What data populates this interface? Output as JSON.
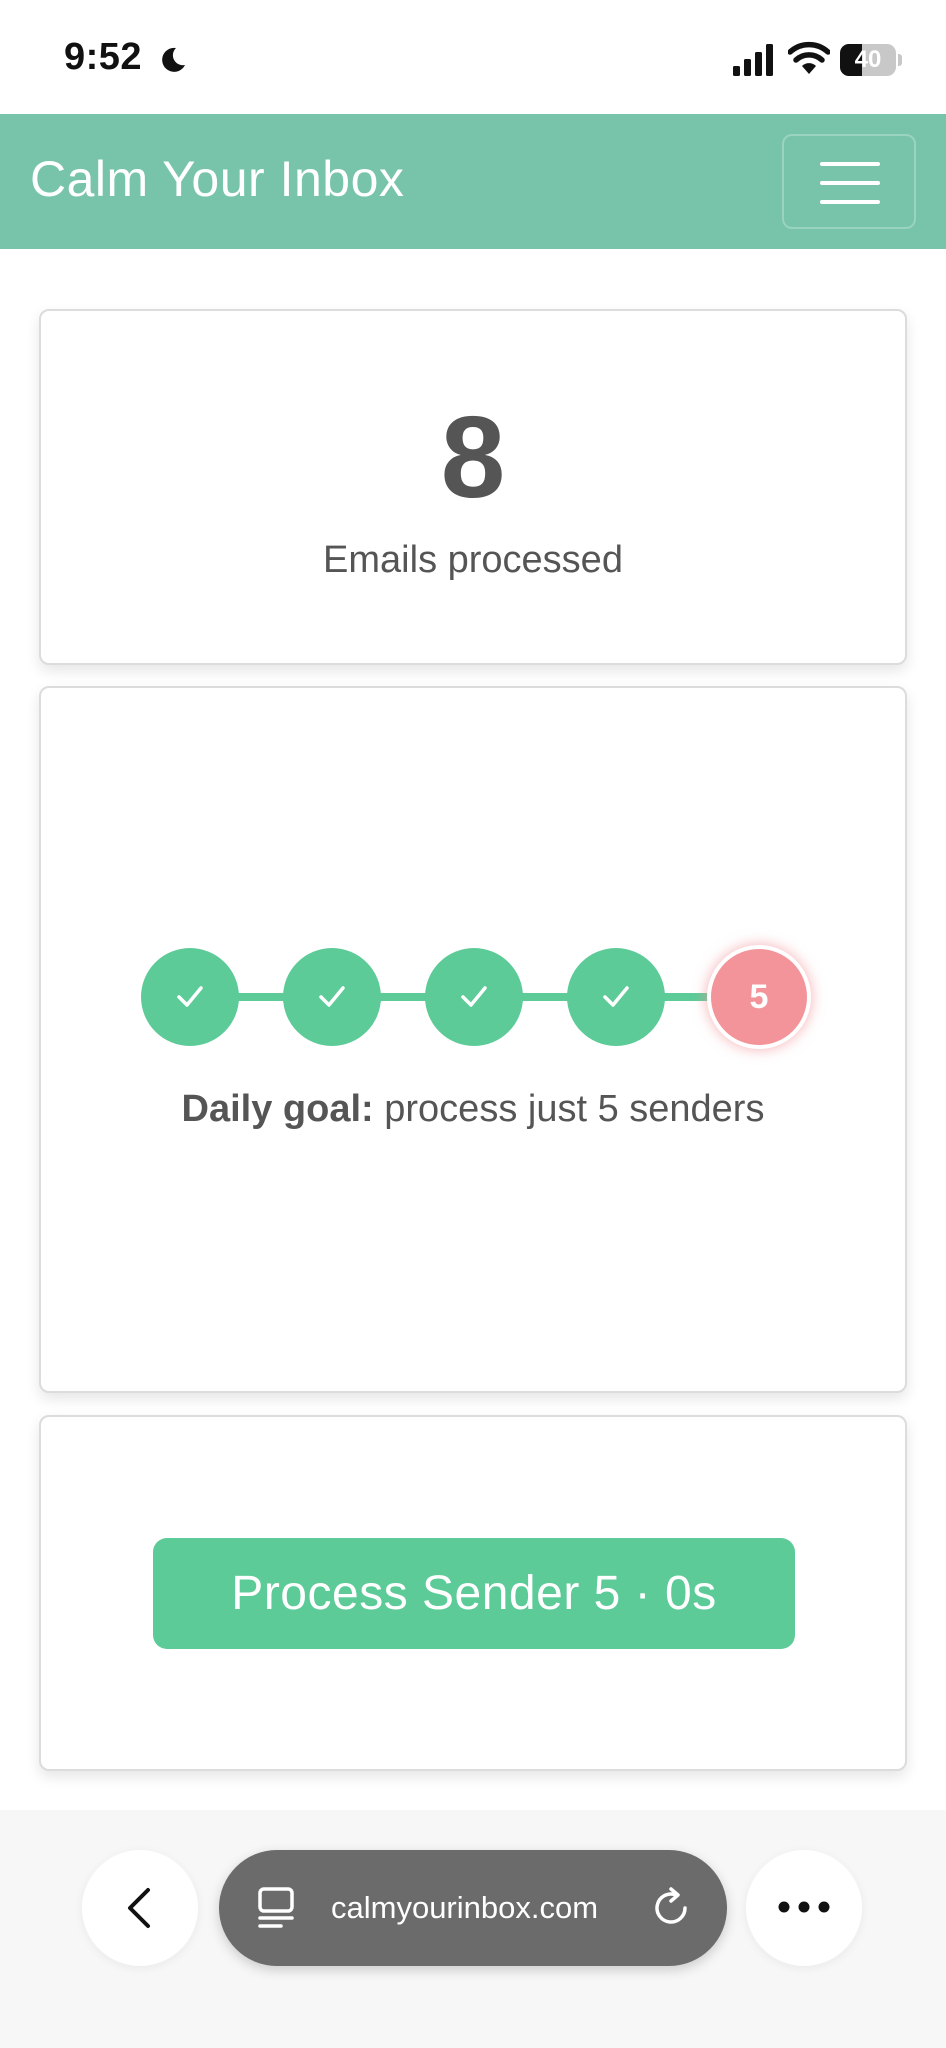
{
  "status_bar": {
    "time": "9:52",
    "battery_level": "40",
    "battery_percent": 40
  },
  "navbar": {
    "brand": "Calm Your Inbox",
    "menu_icon": "hamburger-icon"
  },
  "stats": {
    "count": "8",
    "label": "Emails processed"
  },
  "goal": {
    "steps": [
      {
        "state": "done",
        "icon": "check-icon"
      },
      {
        "state": "done",
        "icon": "check-icon"
      },
      {
        "state": "done",
        "icon": "check-icon"
      },
      {
        "state": "done",
        "icon": "check-icon"
      },
      {
        "state": "current",
        "label": "5"
      }
    ],
    "label_bold": "Daily goal:",
    "label_rest": " process just 5 senders"
  },
  "action": {
    "button_label": "Process Sender 5 · 0s"
  },
  "browser": {
    "url": "calmyourinbox.com"
  },
  "colors": {
    "navbar": "#78c4ab",
    "accent": "#5ccb98",
    "current_step": "#f2949a",
    "text": "#555555"
  }
}
